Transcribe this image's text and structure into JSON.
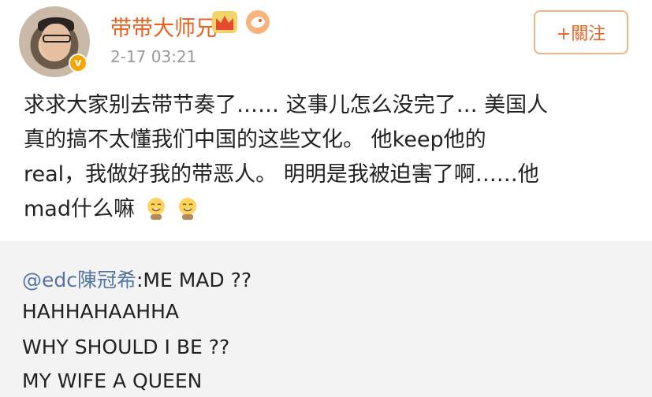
{
  "post": {
    "username": "带带大师兄",
    "timestamp": "2-17 03:21",
    "follow_label": "+關注",
    "text_lines": [
      "求求大家别去带节奏了…… 这事儿怎么没完了… 美国人",
      "真的搞不太懂我们中国的这些文化。 他keep他的",
      "real，我做好我的带恶人。 明明是我被迫害了啊……他",
      "mad什么嘛"
    ],
    "emoji_names": [
      "grin-emoji",
      "grin-emoji"
    ]
  },
  "repost": {
    "mention": "@edc陳冠希",
    "lines": [
      ":ME MAD ??",
      "HAHHAHAAHHA",
      "WHY SHOULD I BE ??",
      "MY WIFE A QUEEN"
    ]
  },
  "colors": {
    "username": "#e8611e",
    "mention": "#5576a5",
    "timestamp": "#999999",
    "repost_bg": "#f3f3f3"
  }
}
